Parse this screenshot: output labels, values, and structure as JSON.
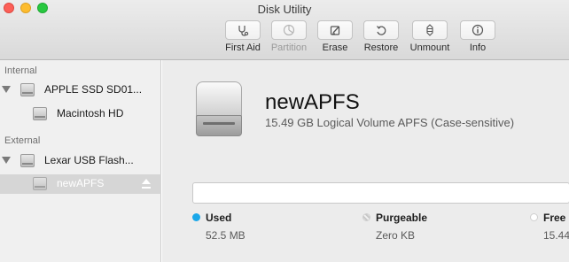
{
  "window": {
    "title": "Disk Utility"
  },
  "toolbar": {
    "first_aid": {
      "label": "First Aid",
      "icon": "stethoscope-icon"
    },
    "partition": {
      "label": "Partition",
      "icon": "partition-icon"
    },
    "erase": {
      "label": "Erase",
      "icon": "erase-icon"
    },
    "restore": {
      "label": "Restore",
      "icon": "restore-icon"
    },
    "unmount": {
      "label": "Unmount",
      "icon": "unmount-icon"
    },
    "info": {
      "label": "Info",
      "icon": "info-icon"
    }
  },
  "sidebar": {
    "internal_header": "Internal",
    "external_header": "External",
    "items": [
      {
        "label": "APPLE SSD SD01...",
        "icon": "internal-disk-icon"
      },
      {
        "label": "Macintosh HD",
        "icon": "volume-icon"
      },
      {
        "label": "Lexar USB Flash...",
        "icon": "external-disk-icon"
      },
      {
        "label": "newAPFS",
        "icon": "volume-icon",
        "selected": true
      }
    ]
  },
  "volume": {
    "name": "newAPFS",
    "description": "15.49 GB Logical Volume APFS (Case-sensitive)"
  },
  "legend": {
    "used": {
      "label": "Used",
      "value": "52.5 MB",
      "color": "#1aa7e9"
    },
    "purgeable": {
      "label": "Purgeable",
      "value": "Zero KB"
    },
    "free": {
      "label": "Free",
      "value": "15.44"
    }
  },
  "colors": {
    "used": "#1aa7e9",
    "selection": "#d6d6d6"
  }
}
